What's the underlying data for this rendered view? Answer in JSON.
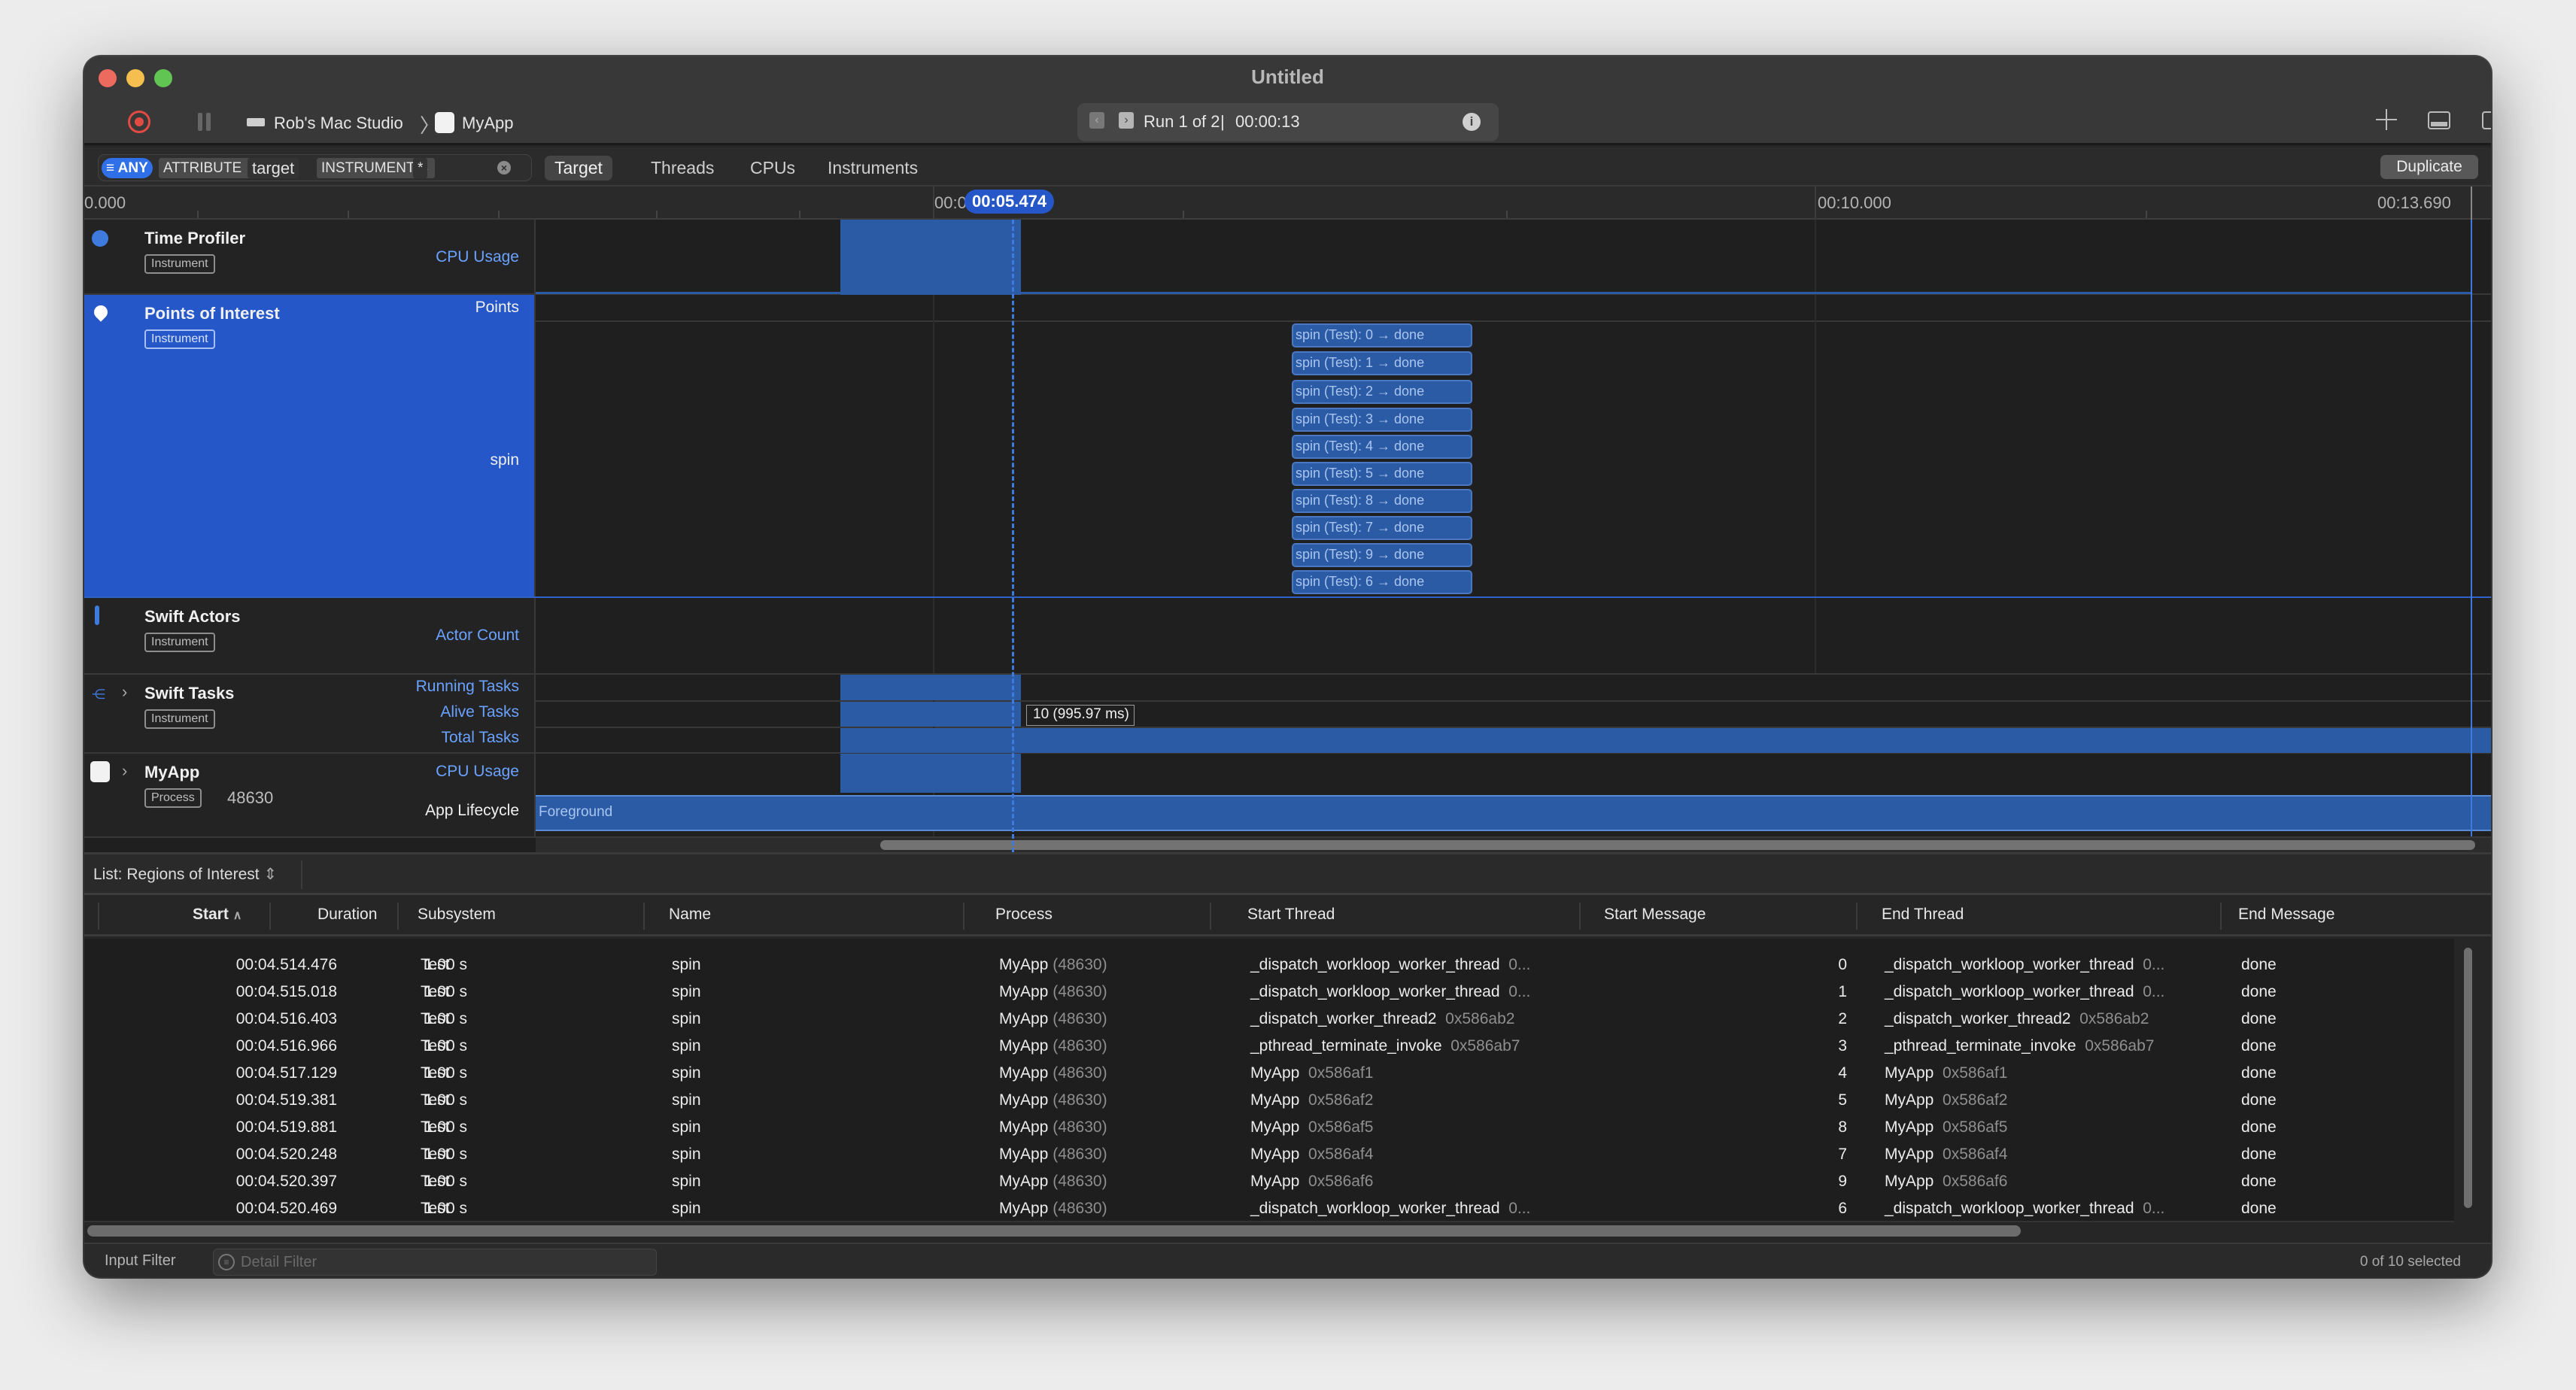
{
  "window": {
    "title": "Untitled",
    "traffic_lights": {
      "close": "#ed6a5e",
      "minimize": "#f5bf4f",
      "zoom": "#61c554"
    }
  },
  "toolbar": {
    "record_icon": "record-icon",
    "pause_icon": "pause-icon",
    "device_name": "Rob's Mac Studio",
    "breadcrumb_separator": "〉",
    "target_app": "MyApp",
    "run_label": "Run 1 of 2",
    "run_separator": "|",
    "run_duration": "00:00:13",
    "add_icon": "plus-icon",
    "bottom_panel_icon": "bottom-panel-icon",
    "inspector_icon": "inspector-icon"
  },
  "filter_bar": {
    "any_label": "ANY",
    "attribute_label": "ATTRIBUTE",
    "attribute_value": "target",
    "instrument_label": "INSTRUMENT",
    "instrument_value": "*",
    "tabs": [
      {
        "label": "Target",
        "selected": true
      },
      {
        "label": "Threads",
        "selected": false
      },
      {
        "label": "CPUs",
        "selected": false
      },
      {
        "label": "Instruments",
        "selected": false
      }
    ],
    "duplicate_label": "Duplicate"
  },
  "ruler": {
    "start_label": "0.000",
    "mid_label_partial": "00:0",
    "cursor_label": "00:05.474",
    "label_10s": "00:10.000",
    "end_label": "00:13.690"
  },
  "tracks": [
    {
      "name": "Time Profiler",
      "badge": "Instrument",
      "icon": "clock-icon",
      "sublabels": [
        "CPU Usage"
      ]
    },
    {
      "name": "Points of Interest",
      "badge": "Instrument",
      "icon": "pin-icon",
      "selected": true,
      "sublabels": [
        "Points",
        "spin"
      ]
    },
    {
      "name": "Swift Actors",
      "badge": "Instrument",
      "icon": "actor-icon",
      "sublabels": [
        "Actor Count"
      ]
    },
    {
      "name": "Swift Tasks",
      "badge": "Instrument",
      "icon": "tasks-icon",
      "sublabels": [
        "Running Tasks",
        "Alive Tasks",
        "Total Tasks"
      ]
    },
    {
      "name": "MyApp",
      "badge": "Process",
      "pid": "48630",
      "icon": "app-icon",
      "sublabels": [
        "CPU Usage",
        "App Lifecycle"
      ]
    }
  ],
  "poi_intervals": [
    "spin (Test): 0 → done",
    "spin (Test): 1 → done",
    "spin (Test): 2 → done",
    "spin (Test): 3 → done",
    "spin (Test): 4 → done",
    "spin (Test): 5 → done",
    "spin (Test): 8 → done",
    "spin (Test): 7 → done",
    "spin (Test): 9 → done",
    "spin (Test): 6 → done"
  ],
  "tooltip": "10 (995.97 ms)",
  "lifecycle_label": "Foreground",
  "list": {
    "selector_label": "List: Regions of Interest",
    "columns": [
      "Start",
      "Duration",
      "Subsystem",
      "Name",
      "Process",
      "Start Thread",
      "Start Message",
      "End Thread",
      "End Message"
    ],
    "sort_column": "Start",
    "sort_direction": "ascending",
    "rows": [
      {
        "start": "00:04.514.476",
        "duration": "1.00 s",
        "subsystem": "Test",
        "name": "spin",
        "process": "MyApp",
        "pid": "(48630)",
        "start_thread": "_dispatch_workloop_worker_thread",
        "start_thread_id": "0...",
        "start_message": "0",
        "end_thread": "_dispatch_workloop_worker_thread",
        "end_thread_id": "0...",
        "end_message": "done"
      },
      {
        "start": "00:04.515.018",
        "duration": "1.00 s",
        "subsystem": "Test",
        "name": "spin",
        "process": "MyApp",
        "pid": "(48630)",
        "start_thread": "_dispatch_workloop_worker_thread",
        "start_thread_id": "0...",
        "start_message": "1",
        "end_thread": "_dispatch_workloop_worker_thread",
        "end_thread_id": "0...",
        "end_message": "done"
      },
      {
        "start": "00:04.516.403",
        "duration": "1.00 s",
        "subsystem": "Test",
        "name": "spin",
        "process": "MyApp",
        "pid": "(48630)",
        "start_thread": "_dispatch_worker_thread2",
        "start_thread_id": "0x586ab2",
        "start_message": "2",
        "end_thread": "_dispatch_worker_thread2",
        "end_thread_id": "0x586ab2",
        "end_message": "done"
      },
      {
        "start": "00:04.516.966",
        "duration": "1.00 s",
        "subsystem": "Test",
        "name": "spin",
        "process": "MyApp",
        "pid": "(48630)",
        "start_thread": "_pthread_terminate_invoke",
        "start_thread_id": "0x586ab7",
        "start_message": "3",
        "end_thread": "_pthread_terminate_invoke",
        "end_thread_id": "0x586ab7",
        "end_message": "done"
      },
      {
        "start": "00:04.517.129",
        "duration": "1.00 s",
        "subsystem": "Test",
        "name": "spin",
        "process": "MyApp",
        "pid": "(48630)",
        "start_thread": "MyApp",
        "start_thread_id": "0x586af1",
        "start_message": "4",
        "end_thread": "MyApp",
        "end_thread_id": "0x586af1",
        "end_message": "done"
      },
      {
        "start": "00:04.519.381",
        "duration": "1.00 s",
        "subsystem": "Test",
        "name": "spin",
        "process": "MyApp",
        "pid": "(48630)",
        "start_thread": "MyApp",
        "start_thread_id": "0x586af2",
        "start_message": "5",
        "end_thread": "MyApp",
        "end_thread_id": "0x586af2",
        "end_message": "done"
      },
      {
        "start": "00:04.519.881",
        "duration": "1.00 s",
        "subsystem": "Test",
        "name": "spin",
        "process": "MyApp",
        "pid": "(48630)",
        "start_thread": "MyApp",
        "start_thread_id": "0x586af5",
        "start_message": "8",
        "end_thread": "MyApp",
        "end_thread_id": "0x586af5",
        "end_message": "done"
      },
      {
        "start": "00:04.520.248",
        "duration": "1.00 s",
        "subsystem": "Test",
        "name": "spin",
        "process": "MyApp",
        "pid": "(48630)",
        "start_thread": "MyApp",
        "start_thread_id": "0x586af4",
        "start_message": "7",
        "end_thread": "MyApp",
        "end_thread_id": "0x586af4",
        "end_message": "done"
      },
      {
        "start": "00:04.520.397",
        "duration": "1.00 s",
        "subsystem": "Test",
        "name": "spin",
        "process": "MyApp",
        "pid": "(48630)",
        "start_thread": "MyApp",
        "start_thread_id": "0x586af6",
        "start_message": "9",
        "end_thread": "MyApp",
        "end_thread_id": "0x586af6",
        "end_message": "done"
      },
      {
        "start": "00:04.520.469",
        "duration": "1.00 s",
        "subsystem": "Test",
        "name": "spin",
        "process": "MyApp",
        "pid": "(48630)",
        "start_thread": "_dispatch_workloop_worker_thread",
        "start_thread_id": "0...",
        "start_message": "6",
        "end_thread": "_dispatch_workloop_worker_thread",
        "end_thread_id": "0...",
        "end_message": "done"
      }
    ]
  },
  "bottom_bar": {
    "input_filter_label": "Input Filter",
    "detail_filter_placeholder": "Detail Filter",
    "selection_status": "0 of 10 selected"
  },
  "colors": {
    "accent": "#2557c8",
    "interval_fill": "#2b5ba5",
    "sublabel_blue": "#6aa2ff"
  }
}
